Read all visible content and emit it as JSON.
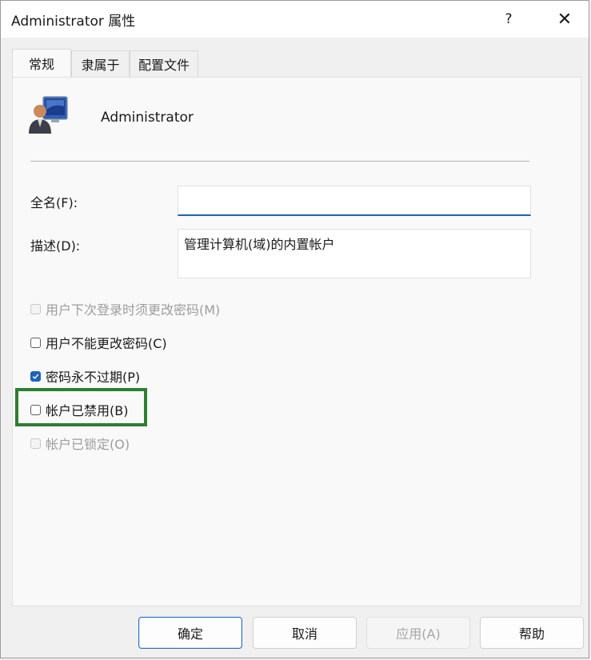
{
  "window": {
    "title": "Administrator 属性",
    "help_glyph": "?",
    "close_glyph": "✕"
  },
  "tabs": [
    {
      "label": "常规",
      "active": true
    },
    {
      "label": "隶属于",
      "active": false
    },
    {
      "label": "配置文件",
      "active": false
    }
  ],
  "user": {
    "name": "Administrator",
    "icon": "user-account-icon"
  },
  "fields": {
    "fullname_label": "全名(F):",
    "fullname_value": "",
    "description_label": "描述(D):",
    "description_value": "管理计算机(域)的内置帐户"
  },
  "options": [
    {
      "label": "用户下次登录时须更改密码(M)",
      "checked": false,
      "enabled": false
    },
    {
      "label": "用户不能更改密码(C)",
      "checked": false,
      "enabled": true
    },
    {
      "label": "密码永不过期(P)",
      "checked": true,
      "enabled": true
    },
    {
      "label": "帐户已禁用(B)",
      "checked": false,
      "enabled": true
    },
    {
      "label": "帐户已锁定(O)",
      "checked": false,
      "enabled": false
    }
  ],
  "buttons": {
    "ok": "确定",
    "cancel": "取消",
    "apply": "应用(A)",
    "help": "帮助"
  },
  "colors": {
    "accent": "#1f62b8",
    "highlight_box": "#2f7d32"
  }
}
